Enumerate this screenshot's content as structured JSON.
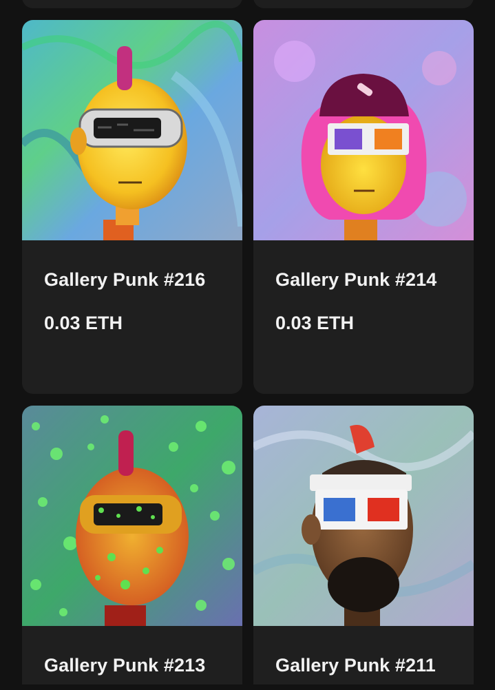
{
  "gallery": {
    "items": [
      {
        "name": "Gallery Punk #216",
        "price": "0.03 ETH",
        "art": "yellow-punk-vr-goggles-icon"
      },
      {
        "name": "Gallery Punk #214",
        "price": "0.03 ETH",
        "art": "pink-hair-punk-3d-glasses-icon"
      },
      {
        "name": "Gallery Punk #213",
        "price": "",
        "art": "orange-punk-dotted-icon"
      },
      {
        "name": "Gallery Punk #211",
        "price": "",
        "art": "mohawk-punk-3d-glasses-icon"
      }
    ]
  },
  "colors": {
    "background": "#121212",
    "card": "#1f1f1f",
    "text": "#f2f2f2"
  }
}
